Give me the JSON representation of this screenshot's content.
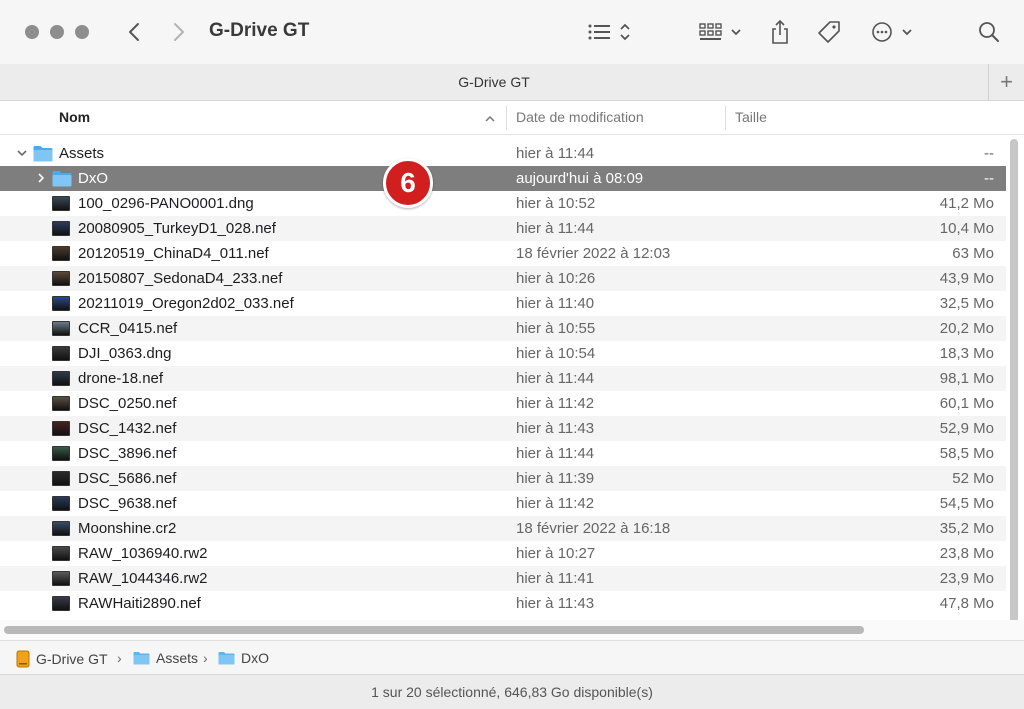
{
  "toolbar": {
    "title": "G-Drive GT",
    "icons": [
      "back-icon",
      "forward-icon",
      "list-view-icon",
      "grid-view-icon",
      "share-icon",
      "tag-icon",
      "more-icon",
      "search-icon"
    ]
  },
  "tab": {
    "title": "G-Drive GT",
    "plus_label": "+"
  },
  "columns": {
    "name": "Nom",
    "date": "Date de modification",
    "size": "Taille"
  },
  "rows": [
    {
      "name": "Assets",
      "date": "hier à 11:44",
      "size": "--",
      "kind": "folder",
      "level": 0,
      "expanded": true
    },
    {
      "name": "DxO",
      "date": "aujourd'hui à 08:09",
      "size": "--",
      "kind": "folder",
      "level": 1,
      "expanded": false,
      "selected": true
    },
    {
      "name": "100_0296-PANO0001.dng",
      "date": "hier à 10:52",
      "size": "41,2 Mo",
      "kind": "image",
      "level": 1
    },
    {
      "name": "20080905_TurkeyD1_028.nef",
      "date": "hier à 11:44",
      "size": "10,4 Mo",
      "kind": "image",
      "level": 1
    },
    {
      "name": "20120519_ChinaD4_011.nef",
      "date": "18 février 2022 à 12:03",
      "size": "63 Mo",
      "kind": "image",
      "level": 1
    },
    {
      "name": "20150807_SedonaD4_233.nef",
      "date": "hier à 10:26",
      "size": "43,9 Mo",
      "kind": "image",
      "level": 1
    },
    {
      "name": "20211019_Oregon2d02_033.nef",
      "date": "hier à 11:40",
      "size": "32,5 Mo",
      "kind": "image",
      "level": 1
    },
    {
      "name": "CCR_0415.nef",
      "date": "hier à 10:55",
      "size": "20,2 Mo",
      "kind": "image",
      "level": 1
    },
    {
      "name": "DJI_0363.dng",
      "date": "hier à 10:54",
      "size": "18,3 Mo",
      "kind": "image",
      "level": 1
    },
    {
      "name": "drone-18.nef",
      "date": "hier à 11:44",
      "size": "98,1 Mo",
      "kind": "image",
      "level": 1
    },
    {
      "name": "DSC_0250.nef",
      "date": "hier à 11:42",
      "size": "60,1 Mo",
      "kind": "image",
      "level": 1
    },
    {
      "name": "DSC_1432.nef",
      "date": "hier à 11:43",
      "size": "52,9 Mo",
      "kind": "image",
      "level": 1
    },
    {
      "name": "DSC_3896.nef",
      "date": "hier à 11:44",
      "size": "58,5 Mo",
      "kind": "image",
      "level": 1
    },
    {
      "name": "DSC_5686.nef",
      "date": "hier à 11:39",
      "size": "52 Mo",
      "kind": "image",
      "level": 1
    },
    {
      "name": "DSC_9638.nef",
      "date": "hier à 11:42",
      "size": "54,5 Mo",
      "kind": "image",
      "level": 1
    },
    {
      "name": "Moonshine.cr2",
      "date": "18 février 2022 à 16:18",
      "size": "35,2 Mo",
      "kind": "image",
      "level": 1
    },
    {
      "name": "RAW_1036940.rw2",
      "date": "hier à 10:27",
      "size": "23,8 Mo",
      "kind": "image",
      "level": 1
    },
    {
      "name": "RAW_1044346.rw2",
      "date": "hier à 11:41",
      "size": "23,9 Mo",
      "kind": "image",
      "level": 1
    },
    {
      "name": "RAWHaiti2890.nef",
      "date": "hier à 11:43",
      "size": "47,8 Mo",
      "kind": "image",
      "level": 1
    }
  ],
  "badge": "6",
  "pathbar": {
    "items": [
      "G-Drive GT",
      "Assets",
      "DxO"
    ],
    "separator": "›"
  },
  "status": "1 sur 20 sélectionné, 646,83 Go disponible(s)",
  "colors": {
    "selection": "#7e7e7e",
    "folder": "#5eb6f0",
    "badge": "#d11f1f",
    "drive": "#f0a21a"
  }
}
